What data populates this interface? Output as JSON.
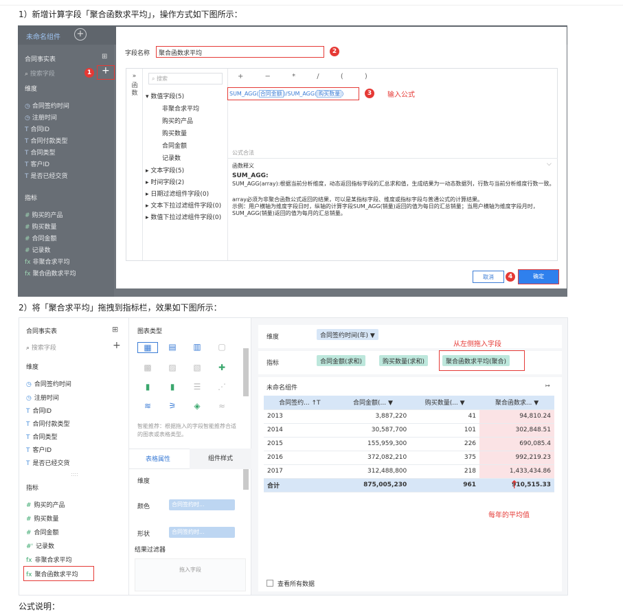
{
  "step1": "1）新增计算字段「聚合函数求平均」，操作方式如下图所示：",
  "step2": "2）将「聚合求平均」拖拽到指标栏，效果如下图所示：",
  "footer": "公式说明：",
  "shot1": {
    "tab_name": "未命名组件",
    "side_title": "合同事实表",
    "search_placeholder": "搜索字段",
    "dim_header": "维度",
    "dims": [
      "合同签约时间",
      "注册时间",
      "合同ID",
      "合同付款类型",
      "合同类型",
      "客户ID",
      "是否已经交货"
    ],
    "measure_header": "指标",
    "measures": [
      "购买的产品",
      "购买数量",
      "合同金额",
      "记录数",
      "非聚合求平均",
      "聚合函数求平均"
    ],
    "dialog": {
      "name_label": "字段名称",
      "name_value": "聚合函数求平均",
      "sidebar_label": "函数",
      "search_placeholder": "搜索",
      "tree_num": "数值字段(5)",
      "num_items": [
        "非聚合求平均",
        "购买的产品",
        "购买数量",
        "合同金额",
        "记录数"
      ],
      "tree_groups": [
        "文本字段(5)",
        "时间字段(2)",
        "日期过滤组件字段(0)",
        "文本下拉过滤组件字段(0)",
        "数值下拉过滤组件字段(0)"
      ],
      "operators": "+ − * / ( )",
      "formula_fn1": "SUM_AGG(",
      "formula_arg1": "合同金额",
      "formula_mid": ")/SUM_AGG(",
      "formula_arg2": "购买数量",
      "formula_end": ")",
      "input_hint": "输入公式",
      "syntax_ok": "公式合法",
      "fn_explain": "函数释义",
      "fn_name": "SUM_AGG:",
      "fn_desc": "SUM_AGG(array):根据当前分析维度，动态返回指标字段的汇总求和值，生成结果为一动态数据列，行数与当前分析维度行数一致。",
      "fn_arr": "array必须为非聚合函数公式返回的结果，可以是某指标字段、维度或指标字段与普通公式的计算结果。",
      "fn_example": "示例：用户横轴为维度字段日时，纵轴的计算字段SUM_AGG(销量)返回的值为每日的汇总销量；当用户横轴为维度字段月时，SUM_AGG(销量)返回的值为每月的汇总销量。",
      "cancel": "取消",
      "ok": "确定"
    },
    "markers": [
      "1",
      "2",
      "3",
      "4"
    ]
  },
  "shot2": {
    "side_title": "合同事实表",
    "search_placeholder": "搜索字段",
    "dim_header": "维度",
    "dims": [
      "合同签约时间",
      "注册时间",
      "合同ID",
      "合同付款类型",
      "合同类型",
      "客户ID",
      "是否已经交货"
    ],
    "measure_header": "指标",
    "measures": [
      "购买的产品",
      "购买数量",
      "合同金额",
      "记录数",
      "非聚合求平均",
      "聚合函数求平均"
    ],
    "chart_type": "图表类型",
    "smart_tip": "智能推荐：根据拖入的字段智能推荐合适的图表或表格类型。",
    "tab_table": "表格属性",
    "tab_style": "组件样式",
    "prop_dim": "维度",
    "prop_color": "颜色",
    "prop_color_val": "合同签约时...",
    "prop_shape": "形状",
    "prop_shape_val": "合同签约时...",
    "filter_title": "结果过滤器",
    "drop_hint": "拖入字段",
    "dim_label": "维度",
    "dim_pill": "合同签约时间(年)",
    "measure_label": "指标",
    "measure_pills": [
      "合同金额(求和)",
      "购买数量(求和)",
      "聚合函数求平均(聚合)"
    ],
    "drag_hint": "从左侧拖入字段",
    "widget_name": "未命名组件",
    "headers": [
      "合同签约...",
      "合同金额(...",
      "购买数量(...",
      "聚合函数求..."
    ],
    "rows": [
      [
        "2013",
        "3,887,220",
        "41",
        "94,810.24"
      ],
      [
        "2014",
        "30,587,700",
        "101",
        "302,848.51"
      ],
      [
        "2015",
        "155,959,300",
        "226",
        "690,085.4"
      ],
      [
        "2016",
        "372,082,210",
        "375",
        "992,219.23"
      ],
      [
        "2017",
        "312,488,800",
        "218",
        "1,433,434.86"
      ]
    ],
    "total": [
      "合计",
      "875,005,230",
      "961",
      "910,515.33"
    ],
    "avg_note": "每年的平均值",
    "view_all": "查看所有数据"
  }
}
